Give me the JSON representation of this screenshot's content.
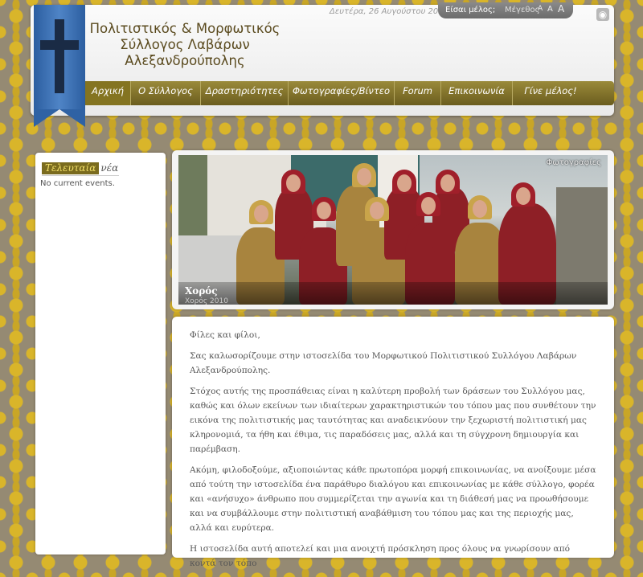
{
  "header": {
    "title_lines": [
      "Πολιτιστικός & Μορφωτικός",
      "Σύλλογος Λαβάρων",
      "Αλεξανδρούπολης"
    ],
    "date": "Δευτέρα, 26 Αυγούστου 2013",
    "member_label": "Είσαι μέλος;",
    "size_label": "Μέγεθος",
    "font_sizes": [
      "A",
      "A",
      "A"
    ],
    "rss_icon": "rss-icon"
  },
  "nav": {
    "items": [
      {
        "label": "Αρχική",
        "active": true
      },
      {
        "label": "Ο Σύλλογος"
      },
      {
        "label": "Δραστηριότητες"
      },
      {
        "label": "Φωτογραφίες/Βίντεο"
      },
      {
        "label": "Forum"
      },
      {
        "label": "Επικοινωνία"
      },
      {
        "label": "Γίνε μέλος!"
      }
    ]
  },
  "sidebar": {
    "title_highlight": "Τελευταία",
    "title_rest": "νέα",
    "no_events": "No current events."
  },
  "slideshow": {
    "title": "Χορός",
    "subtitle": "Χορός 2010",
    "category": "Φωτογραφίες"
  },
  "content": {
    "paragraphs": [
      "Φίλες και φίλοι,",
      "Σας καλωσορίζουμε στην ιστοσελίδα του Μορφωτικού Πολιτιστικού Συλλόγου Λαβάρων Αλεξανδρούπολης.",
      "Στόχος αυτής της προσπάθειας είναι η καλύτερη προβολή των δράσεων του Συλλόγου μας, καθώς και όλων εκείνων των ιδιαίτερων χαρακτηριστικών του τόπου μας που συνθέτουν την εικόνα της πολιτιστικής μας ταυτότητας και αναδεικνύουν την ξεχωριστή πολιτιστική μας κληρονομιά, τα ήθη και έθιμα, τις παραδόσεις μας, αλλά και τη σύγχρονη δημιουργία και παρέμβαση.",
      "Ακόμη, φιλοδοξούμε, αξιοποιώντας κάθε πρωτοπόρα μορφή επικοινωνίας, να ανοίξουμε μέσα από τούτη την ιστοσελίδα ένα παράθυρο διαλόγου και επικοινωνίας με κάθε σύλλογο, φορέα και «ανήσυχο» άνθρωπο που συμμερίζεται την αγωνία και τη διάθεσή μας να προωθήσουμε και να συμβάλλουμε στην πολιτιστική αναβάθμιση του τόπου μας και της περιοχής μας, αλλά και ευρύτερα.",
      "Η ιστοσελίδα αυτή αποτελεί και μια ανοιχτή πρόσκληση προς όλους να γνωρίσουν από κοντά τον τόπο"
    ]
  },
  "colors": {
    "gold": "#d9b52a",
    "nav": "#7a6b1e",
    "banner": "#2f62a4"
  }
}
